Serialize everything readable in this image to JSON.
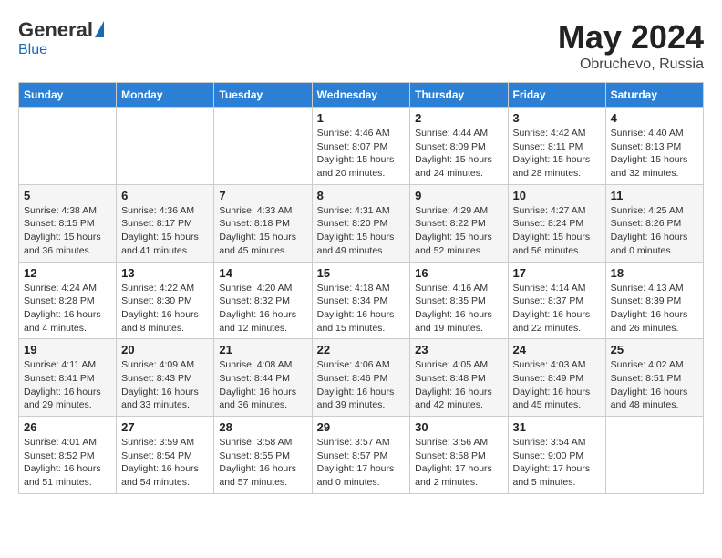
{
  "header": {
    "logo_general": "General",
    "logo_blue": "Blue",
    "title": "May 2024",
    "location": "Obruchevo, Russia"
  },
  "days_of_week": [
    "Sunday",
    "Monday",
    "Tuesday",
    "Wednesday",
    "Thursday",
    "Friday",
    "Saturday"
  ],
  "weeks": [
    [
      {
        "day": "",
        "info": ""
      },
      {
        "day": "",
        "info": ""
      },
      {
        "day": "",
        "info": ""
      },
      {
        "day": "1",
        "info": "Sunrise: 4:46 AM\nSunset: 8:07 PM\nDaylight: 15 hours\nand 20 minutes."
      },
      {
        "day": "2",
        "info": "Sunrise: 4:44 AM\nSunset: 8:09 PM\nDaylight: 15 hours\nand 24 minutes."
      },
      {
        "day": "3",
        "info": "Sunrise: 4:42 AM\nSunset: 8:11 PM\nDaylight: 15 hours\nand 28 minutes."
      },
      {
        "day": "4",
        "info": "Sunrise: 4:40 AM\nSunset: 8:13 PM\nDaylight: 15 hours\nand 32 minutes."
      }
    ],
    [
      {
        "day": "5",
        "info": "Sunrise: 4:38 AM\nSunset: 8:15 PM\nDaylight: 15 hours\nand 36 minutes."
      },
      {
        "day": "6",
        "info": "Sunrise: 4:36 AM\nSunset: 8:17 PM\nDaylight: 15 hours\nand 41 minutes."
      },
      {
        "day": "7",
        "info": "Sunrise: 4:33 AM\nSunset: 8:18 PM\nDaylight: 15 hours\nand 45 minutes."
      },
      {
        "day": "8",
        "info": "Sunrise: 4:31 AM\nSunset: 8:20 PM\nDaylight: 15 hours\nand 49 minutes."
      },
      {
        "day": "9",
        "info": "Sunrise: 4:29 AM\nSunset: 8:22 PM\nDaylight: 15 hours\nand 52 minutes."
      },
      {
        "day": "10",
        "info": "Sunrise: 4:27 AM\nSunset: 8:24 PM\nDaylight: 15 hours\nand 56 minutes."
      },
      {
        "day": "11",
        "info": "Sunrise: 4:25 AM\nSunset: 8:26 PM\nDaylight: 16 hours\nand 0 minutes."
      }
    ],
    [
      {
        "day": "12",
        "info": "Sunrise: 4:24 AM\nSunset: 8:28 PM\nDaylight: 16 hours\nand 4 minutes."
      },
      {
        "day": "13",
        "info": "Sunrise: 4:22 AM\nSunset: 8:30 PM\nDaylight: 16 hours\nand 8 minutes."
      },
      {
        "day": "14",
        "info": "Sunrise: 4:20 AM\nSunset: 8:32 PM\nDaylight: 16 hours\nand 12 minutes."
      },
      {
        "day": "15",
        "info": "Sunrise: 4:18 AM\nSunset: 8:34 PM\nDaylight: 16 hours\nand 15 minutes."
      },
      {
        "day": "16",
        "info": "Sunrise: 4:16 AM\nSunset: 8:35 PM\nDaylight: 16 hours\nand 19 minutes."
      },
      {
        "day": "17",
        "info": "Sunrise: 4:14 AM\nSunset: 8:37 PM\nDaylight: 16 hours\nand 22 minutes."
      },
      {
        "day": "18",
        "info": "Sunrise: 4:13 AM\nSunset: 8:39 PM\nDaylight: 16 hours\nand 26 minutes."
      }
    ],
    [
      {
        "day": "19",
        "info": "Sunrise: 4:11 AM\nSunset: 8:41 PM\nDaylight: 16 hours\nand 29 minutes."
      },
      {
        "day": "20",
        "info": "Sunrise: 4:09 AM\nSunset: 8:43 PM\nDaylight: 16 hours\nand 33 minutes."
      },
      {
        "day": "21",
        "info": "Sunrise: 4:08 AM\nSunset: 8:44 PM\nDaylight: 16 hours\nand 36 minutes."
      },
      {
        "day": "22",
        "info": "Sunrise: 4:06 AM\nSunset: 8:46 PM\nDaylight: 16 hours\nand 39 minutes."
      },
      {
        "day": "23",
        "info": "Sunrise: 4:05 AM\nSunset: 8:48 PM\nDaylight: 16 hours\nand 42 minutes."
      },
      {
        "day": "24",
        "info": "Sunrise: 4:03 AM\nSunset: 8:49 PM\nDaylight: 16 hours\nand 45 minutes."
      },
      {
        "day": "25",
        "info": "Sunrise: 4:02 AM\nSunset: 8:51 PM\nDaylight: 16 hours\nand 48 minutes."
      }
    ],
    [
      {
        "day": "26",
        "info": "Sunrise: 4:01 AM\nSunset: 8:52 PM\nDaylight: 16 hours\nand 51 minutes."
      },
      {
        "day": "27",
        "info": "Sunrise: 3:59 AM\nSunset: 8:54 PM\nDaylight: 16 hours\nand 54 minutes."
      },
      {
        "day": "28",
        "info": "Sunrise: 3:58 AM\nSunset: 8:55 PM\nDaylight: 16 hours\nand 57 minutes."
      },
      {
        "day": "29",
        "info": "Sunrise: 3:57 AM\nSunset: 8:57 PM\nDaylight: 17 hours\nand 0 minutes."
      },
      {
        "day": "30",
        "info": "Sunrise: 3:56 AM\nSunset: 8:58 PM\nDaylight: 17 hours\nand 2 minutes."
      },
      {
        "day": "31",
        "info": "Sunrise: 3:54 AM\nSunset: 9:00 PM\nDaylight: 17 hours\nand 5 minutes."
      },
      {
        "day": "",
        "info": ""
      }
    ]
  ]
}
